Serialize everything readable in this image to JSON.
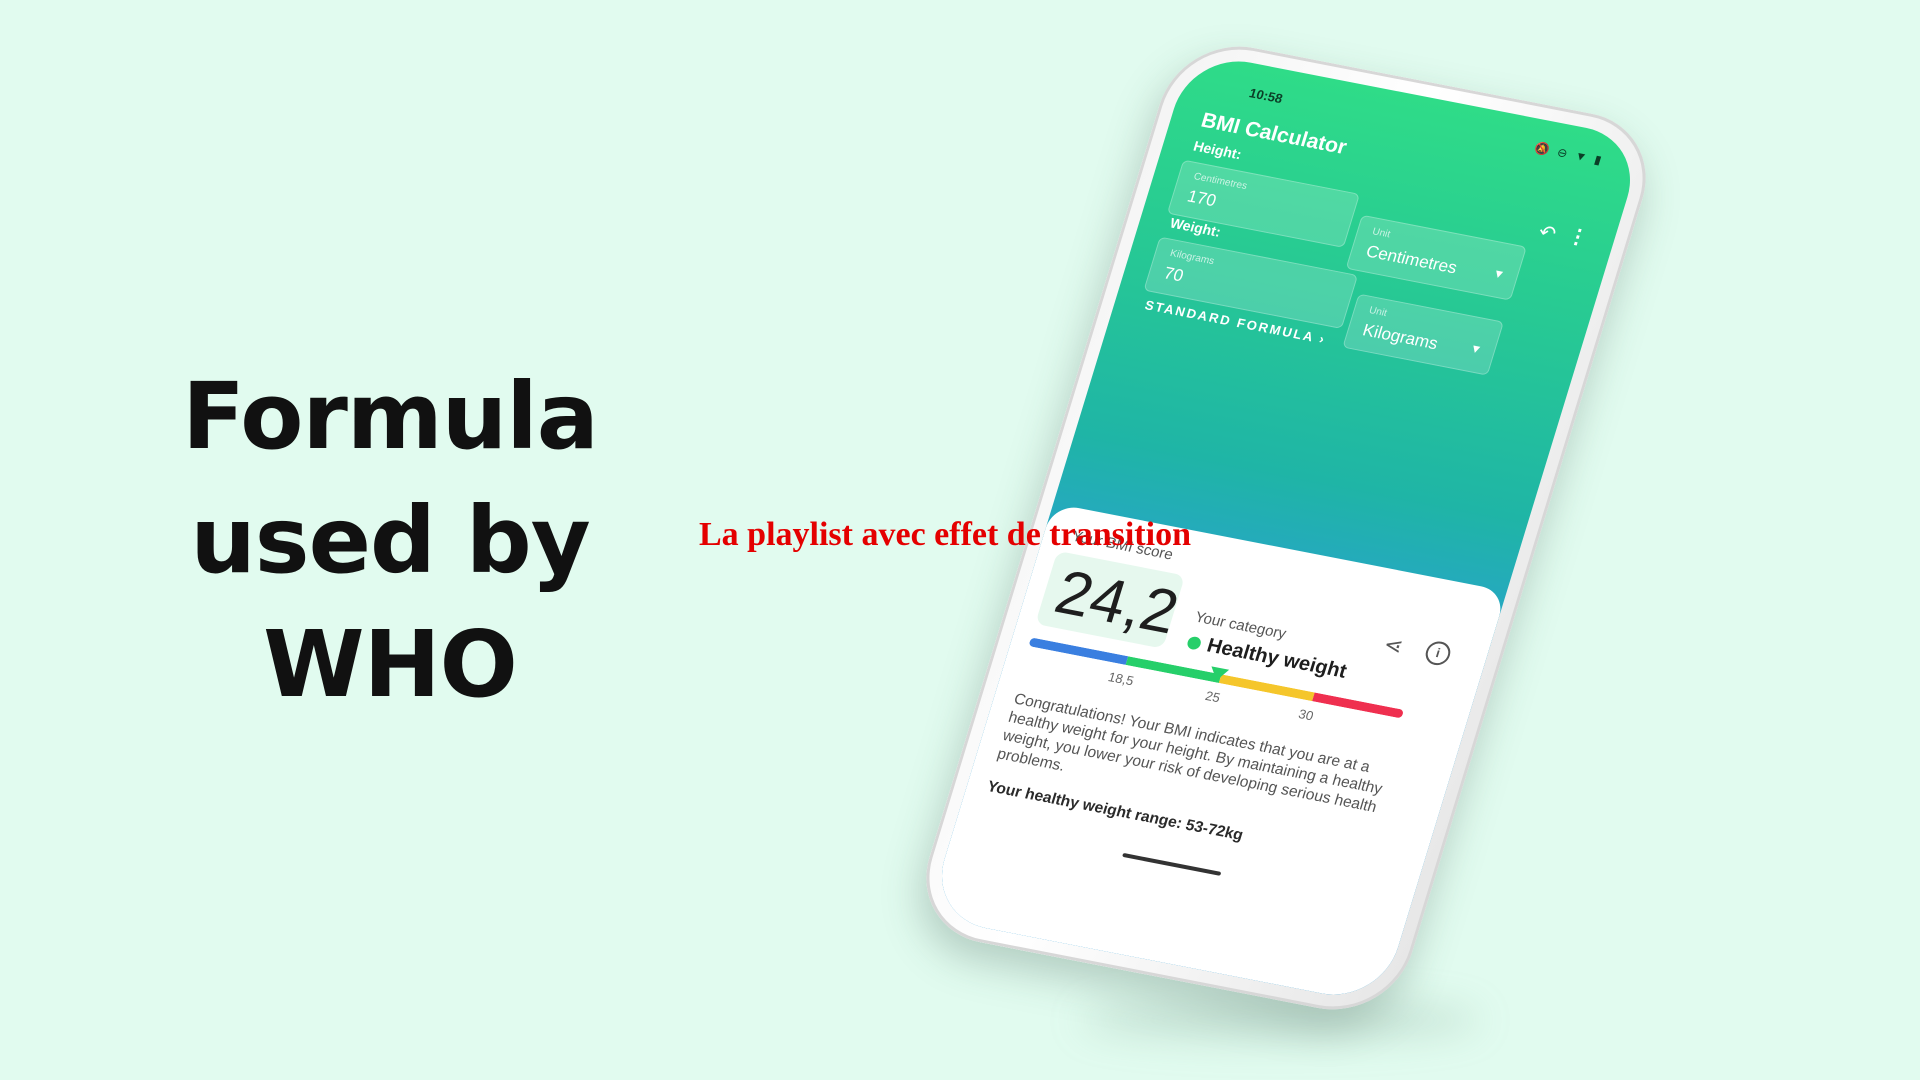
{
  "headline": {
    "lines": [
      "Formula",
      "used by",
      "WHO"
    ]
  },
  "overlay_caption": "La playlist avec effet de transition",
  "phone": {
    "status_bar": {
      "time": "10:58",
      "icons": [
        "mute-icon",
        "dnd-icon",
        "wifi-icon",
        "battery-icon"
      ]
    },
    "app_bar": {
      "title": "BMI Calculator",
      "actions": [
        "undo-icon",
        "more-vert-icon"
      ]
    },
    "height": {
      "label": "Height:",
      "input_caption": "Centimetres",
      "input_value": "170",
      "unit_caption": "Unit",
      "unit_value": "Centimetres"
    },
    "weight": {
      "label": "Weight:",
      "input_caption": "Kilograms",
      "input_value": "70",
      "unit_caption": "Unit",
      "unit_value": "Kilograms"
    },
    "formula_link": "STANDARD FORMULA",
    "result": {
      "score_label": "Your BMI score",
      "score_value": "24,2",
      "category_label": "Your category",
      "category_value": "Healthy weight",
      "scale": {
        "segment_colors": [
          "#3a7fe0",
          "#26cf6a",
          "#f5c62b",
          "#ef2f4f"
        ],
        "ticks": [
          "18,5",
          "25",
          "30"
        ],
        "marker_value": 24.2
      },
      "message": "Congratulations! Your BMI indicates that you are at a healthy weight for your height. By maintaining a healthy weight, you lower your risk of developing serious health problems.",
      "range": "Your healthy weight range: 53-72kg"
    }
  }
}
